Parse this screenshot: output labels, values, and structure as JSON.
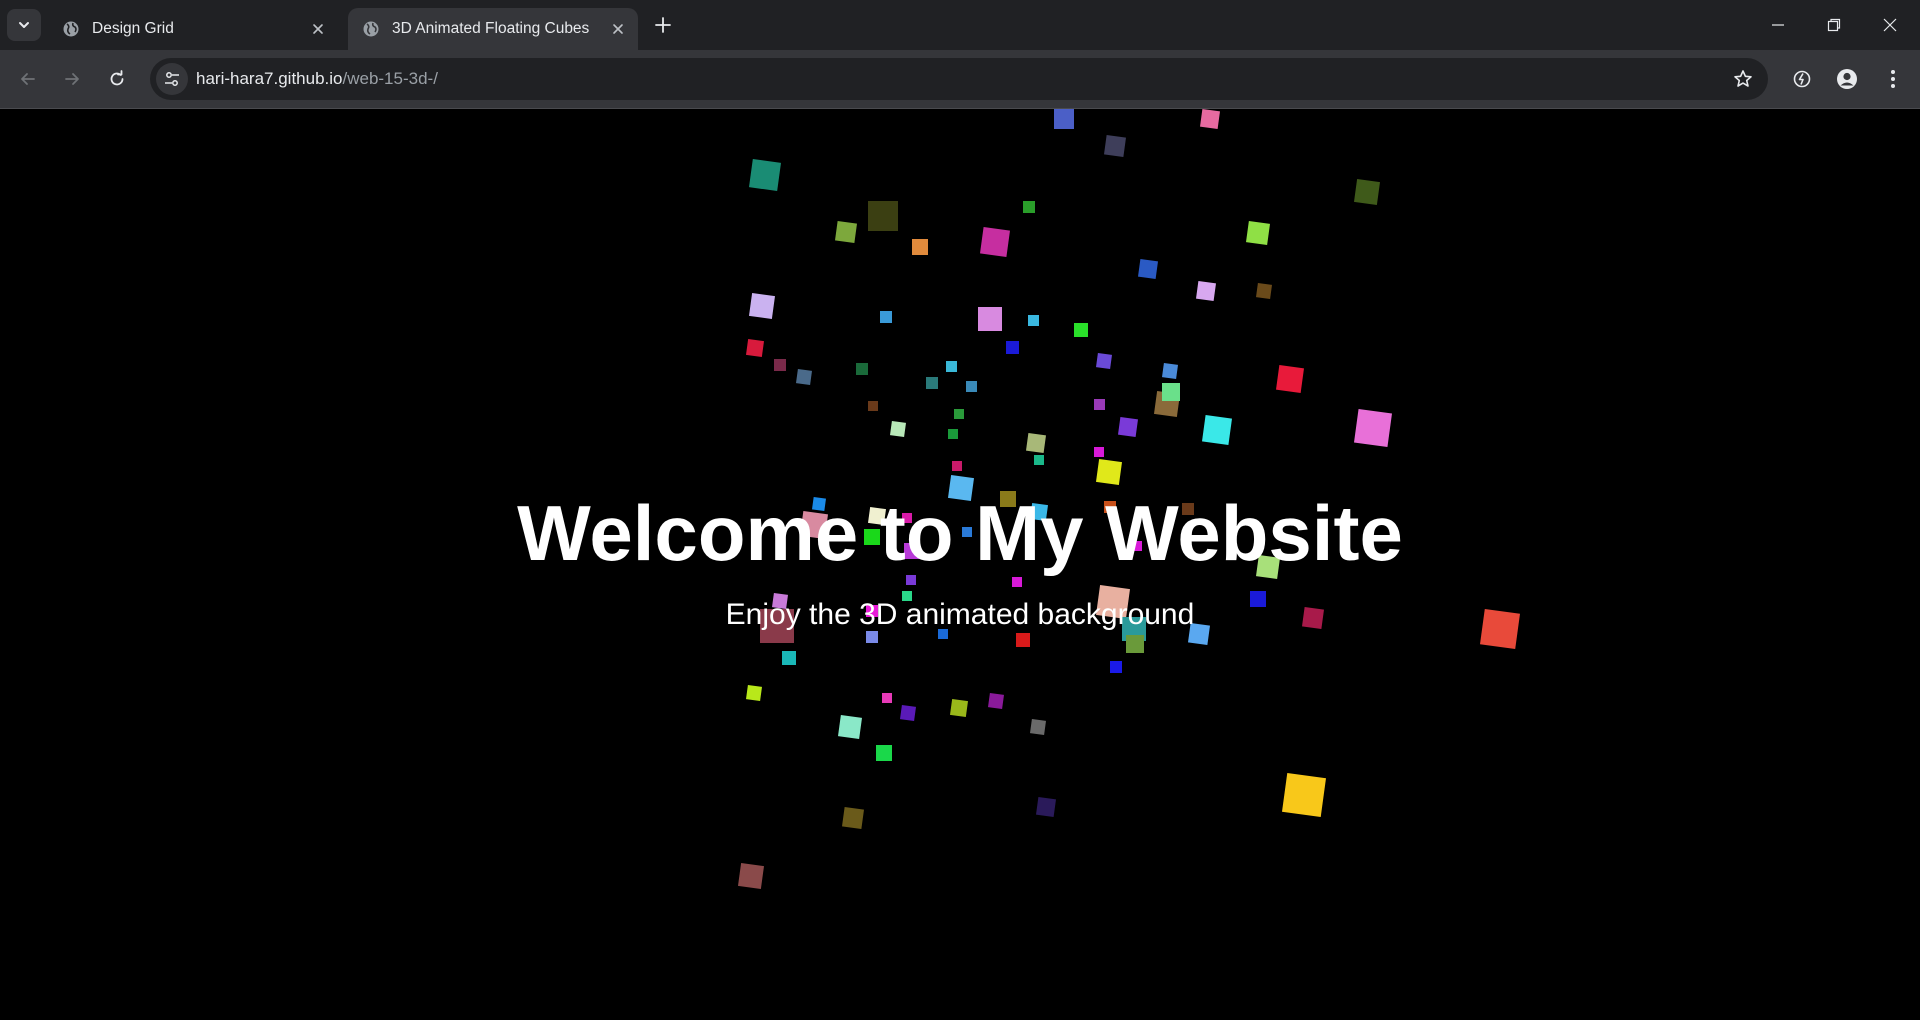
{
  "browser": {
    "tabs": [
      {
        "title": "Design Grid",
        "active": false,
        "icon": "globe-icon"
      },
      {
        "title": "3D Animated Floating Cubes",
        "active": true,
        "icon": "globe-icon"
      }
    ],
    "url_host": "hari-hara7.github.io",
    "url_path": "/web-15-3d-/"
  },
  "page": {
    "heading": "Welcome to My Website",
    "subheading": "Enjoy the 3D animated background",
    "background_color": "#000000"
  },
  "colors": {
    "chrome_tabstrip": "#202124",
    "chrome_toolbar": "#35363a",
    "omnibox": "#202124",
    "text": "#e8eaed"
  }
}
